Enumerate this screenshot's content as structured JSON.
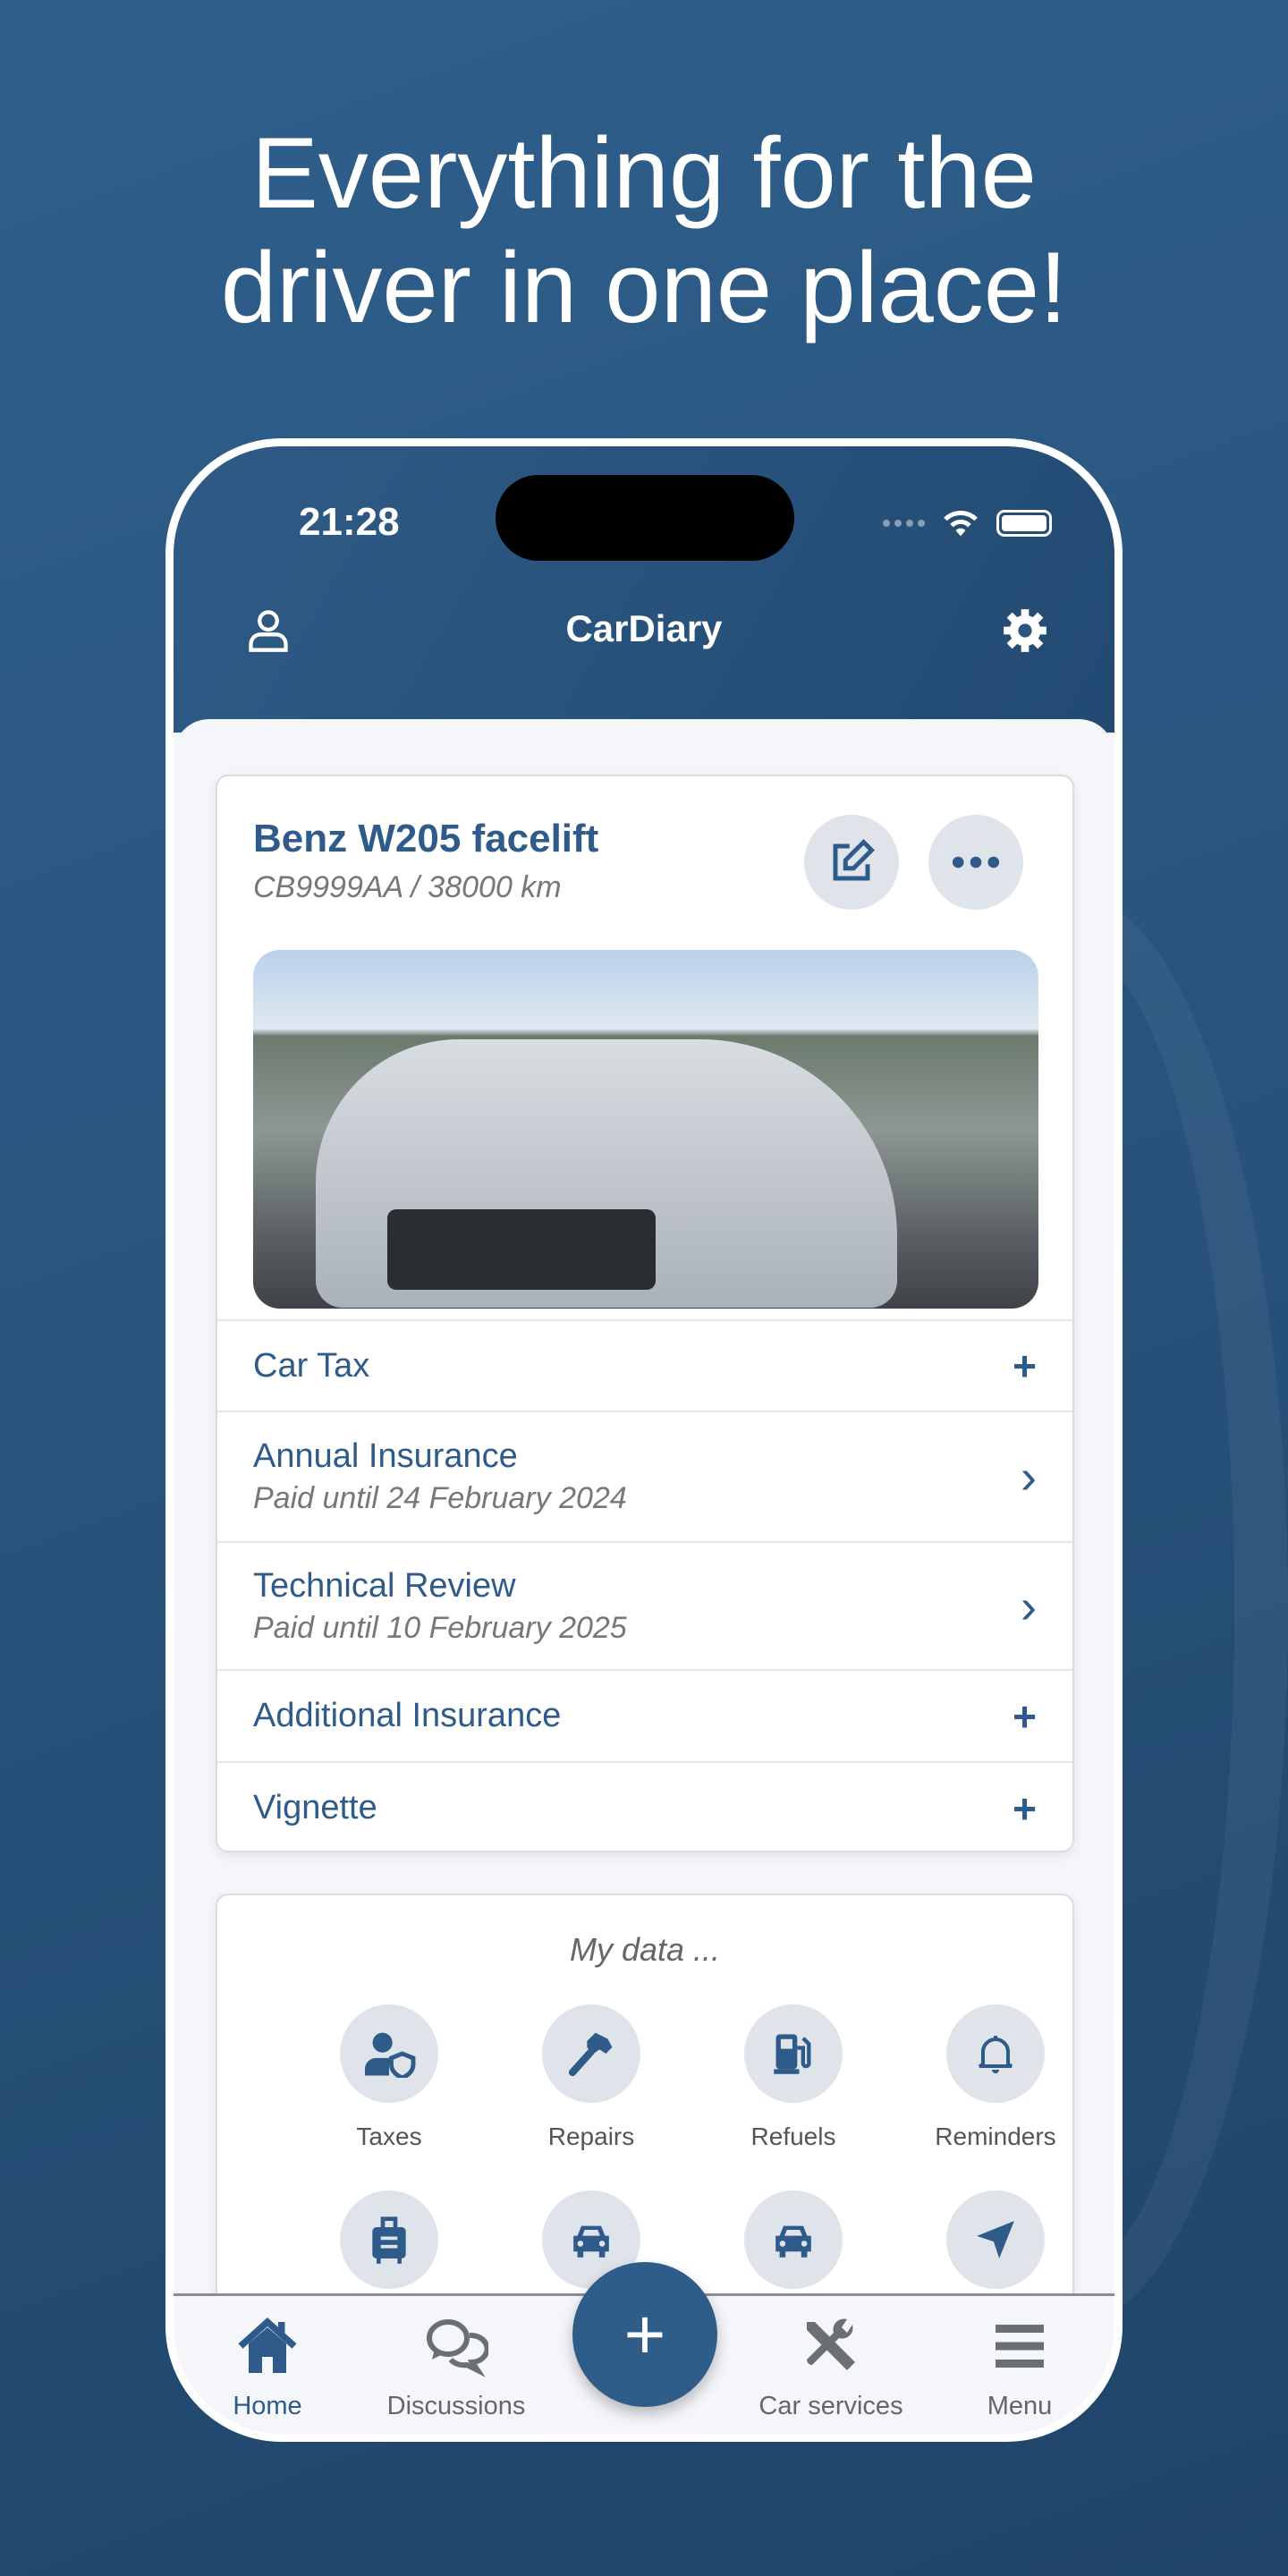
{
  "headline": {
    "line1": "Everything for the",
    "line2": "driver in one place!"
  },
  "status_bar": {
    "time": "21:28"
  },
  "nav": {
    "title": "CarDiary",
    "left_icon": "user-icon",
    "right_icon": "gear-icon"
  },
  "car": {
    "name": "Benz W205 facelift",
    "plate": "CB9999AA",
    "mileage": "38000 km",
    "subtitle": "CB9999AA /  38000 km"
  },
  "rows": [
    {
      "label": "Car Tax",
      "sub": "",
      "action": "+"
    },
    {
      "label": "Annual Insurance",
      "sub": "Paid until 24 February 2024",
      "action": "›"
    },
    {
      "label": "Technical Review",
      "sub": "Paid until 10 February 2025",
      "action": "›"
    },
    {
      "label": "Additional Insurance",
      "sub": "",
      "action": "+"
    },
    {
      "label": "Vignette",
      "sub": "",
      "action": "+"
    }
  ],
  "my_data": {
    "title": "My data ...",
    "tiles": [
      {
        "label": "Taxes",
        "icon": "user-shield-icon"
      },
      {
        "label": "Repairs",
        "icon": "hammer-icon"
      },
      {
        "label": "Refuels",
        "icon": "fuel-pump-icon"
      },
      {
        "label": "Reminders",
        "icon": "bell-icon"
      },
      {
        "label": "",
        "icon": "suitcase-icon"
      },
      {
        "label": "",
        "icon": "car-icon"
      },
      {
        "label": "",
        "icon": "car-icon"
      },
      {
        "label": "",
        "icon": "location-arrow-icon"
      }
    ]
  },
  "tabs": [
    {
      "label": "Home",
      "active": true
    },
    {
      "label": "Discussions"
    },
    {
      "label": "Car services"
    },
    {
      "label": "Menu"
    }
  ],
  "fab": {
    "label": "+"
  },
  "colors": {
    "accent": "#2e5b8a",
    "background": "#2a5680",
    "tile": "#dfe3ea"
  }
}
